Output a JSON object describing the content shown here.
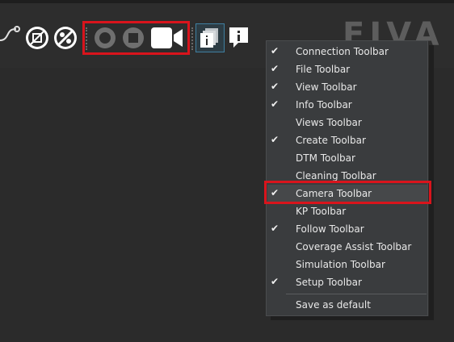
{
  "colors": {
    "highlight_red": "#d9141c",
    "menu_bg": "#3a3c3e",
    "toolbar_bg": "#2d2d2d",
    "text": "#e8e8e8"
  },
  "toolbar": {
    "icons": [
      "route-icon",
      "chip-icon",
      "no-fill-icon",
      "record-icon",
      "stop-icon",
      "video-camera-icon",
      "info-stack-icon",
      "info-balloon-icon"
    ]
  },
  "brand_text": "EIVA",
  "context_menu": {
    "items": [
      {
        "label": "Connection Toolbar",
        "checked": true
      },
      {
        "label": "File Toolbar",
        "checked": true
      },
      {
        "label": "View Toolbar",
        "checked": true
      },
      {
        "label": "Info Toolbar",
        "checked": true
      },
      {
        "label": "Views Toolbar",
        "checked": false
      },
      {
        "label": "Create Toolbar",
        "checked": true
      },
      {
        "label": "DTM Toolbar",
        "checked": false
      },
      {
        "label": "Cleaning Toolbar",
        "checked": false
      },
      {
        "label": "Camera Toolbar",
        "checked": true,
        "highlighted": true
      },
      {
        "label": "KP Toolbar",
        "checked": false
      },
      {
        "label": "Follow Toolbar",
        "checked": true
      },
      {
        "label": "Coverage Assist Toolbar",
        "checked": false
      },
      {
        "label": "Simulation Toolbar",
        "checked": false
      },
      {
        "label": "Setup Toolbar",
        "checked": true
      }
    ],
    "save_default": "Save as default"
  }
}
